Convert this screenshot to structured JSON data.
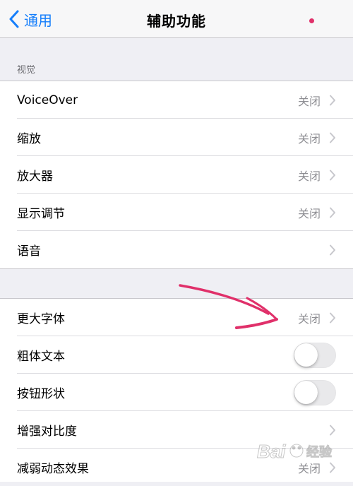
{
  "nav": {
    "back_label": "通用",
    "title": "辅助功能"
  },
  "vision": {
    "header": "视觉",
    "items": [
      {
        "label": "VoiceOver",
        "value": "关闭"
      },
      {
        "label": "缩放",
        "value": "关闭"
      },
      {
        "label": "放大器",
        "value": "关闭"
      },
      {
        "label": "显示调节",
        "value": "关闭"
      },
      {
        "label": "语音",
        "value": ""
      }
    ]
  },
  "text": {
    "items": [
      {
        "label": "更大字体",
        "value": "关闭"
      },
      {
        "label": "粗体文本",
        "toggle": false
      },
      {
        "label": "按钮形状",
        "toggle": false
      },
      {
        "label": "增强对比度",
        "value": ""
      },
      {
        "label": "减弱动态效果",
        "value": "关闭"
      }
    ]
  },
  "watermark": {
    "text": "Baidu 经验"
  },
  "colors": {
    "accent": "#157efb",
    "annotation": "#e0306a",
    "background": "#efeff4"
  }
}
